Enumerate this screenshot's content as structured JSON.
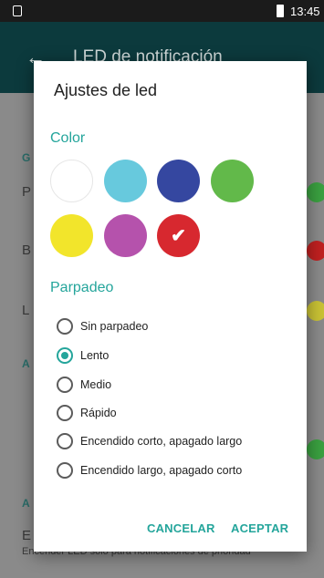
{
  "status_bar": {
    "time": "13:45"
  },
  "background": {
    "title": "LED de notificación",
    "items": [
      "P",
      "B",
      "L"
    ],
    "subheaders": [
      "G",
      "A",
      "A"
    ],
    "footer_line1": "E",
    "footer_line2": "Encender LED sólo para notificaciones de prioridad"
  },
  "dialog": {
    "title": "Ajustes de led",
    "color_section": "Color",
    "colors": [
      {
        "name": "white",
        "hex": "#ffffff"
      },
      {
        "name": "cyan",
        "hex": "#67c9dd"
      },
      {
        "name": "indigo",
        "hex": "#3547a0"
      },
      {
        "name": "green",
        "hex": "#62b94a"
      },
      {
        "name": "yellow",
        "hex": "#f2e52b"
      },
      {
        "name": "purple",
        "hex": "#b552ac"
      },
      {
        "name": "red",
        "hex": "#d7282f"
      }
    ],
    "selected_color": "red",
    "blink_section": "Parpadeo",
    "blink_options": [
      "Sin parpadeo",
      "Lento",
      "Medio",
      "Rápido",
      "Encendido corto, apagado largo",
      "Encendido largo, apagado corto"
    ],
    "selected_blink": "Lento",
    "cancel": "CANCELAR",
    "accept": "ACEPTAR"
  },
  "colors": {
    "accent": "#24a59b",
    "appbar": "#0c3a3d"
  }
}
